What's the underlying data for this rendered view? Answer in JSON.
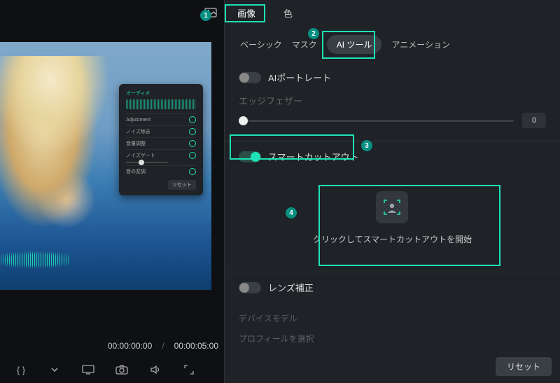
{
  "left": {
    "timecodes": {
      "current": "00:00:00:00",
      "duration": "00:00:05:00"
    },
    "float_panel": {
      "tab_active": "オーディオ",
      "rows": [
        "Adjustment",
        "ノイズ除去",
        "音量調整",
        "ノイズゲート",
        "音の変調"
      ],
      "btn": "リセット"
    },
    "toolbar_icons": [
      "braces-icon",
      "chevron-down-icon",
      "monitor-icon",
      "camera-icon",
      "speaker-icon",
      "expand-icon"
    ]
  },
  "right": {
    "top_tabs": {
      "image": "画像",
      "color": "色"
    },
    "sub_tabs": {
      "basic": "ベーシック",
      "mask": "マスク",
      "ai_tools": "AI ツール",
      "animation": "アニメーション"
    },
    "ai_portrait": {
      "label": "AIポートレート",
      "on": false
    },
    "edge_feather": {
      "label": "エッジフェザー",
      "value": "0"
    },
    "smart_cutout": {
      "label": "スマートカットアウト",
      "on": true,
      "prompt": "クリックしてスマートカットアウトを開始"
    },
    "lens_correction": {
      "label": "レンズ補正",
      "on": false
    },
    "device_model": "デバイスモデル",
    "profile_select": "プロフィールを選択",
    "reset": "リセット"
  },
  "markers": {
    "m1": "1",
    "m2": "2",
    "m3": "3",
    "m4": "4"
  }
}
